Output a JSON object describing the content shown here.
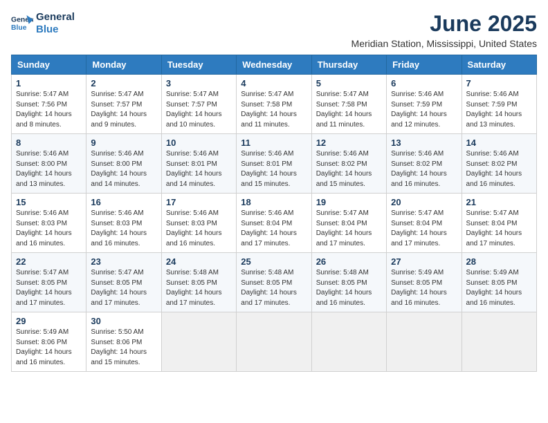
{
  "logo": {
    "line1": "General",
    "line2": "Blue"
  },
  "title": "June 2025",
  "subtitle": "Meridian Station, Mississippi, United States",
  "weekdays": [
    "Sunday",
    "Monday",
    "Tuesday",
    "Wednesday",
    "Thursday",
    "Friday",
    "Saturday"
  ],
  "weeks": [
    [
      {
        "day": "1",
        "sunrise": "Sunrise: 5:47 AM",
        "sunset": "Sunset: 7:56 PM",
        "daylight": "Daylight: 14 hours and 8 minutes."
      },
      {
        "day": "2",
        "sunrise": "Sunrise: 5:47 AM",
        "sunset": "Sunset: 7:57 PM",
        "daylight": "Daylight: 14 hours and 9 minutes."
      },
      {
        "day": "3",
        "sunrise": "Sunrise: 5:47 AM",
        "sunset": "Sunset: 7:57 PM",
        "daylight": "Daylight: 14 hours and 10 minutes."
      },
      {
        "day": "4",
        "sunrise": "Sunrise: 5:47 AM",
        "sunset": "Sunset: 7:58 PM",
        "daylight": "Daylight: 14 hours and 11 minutes."
      },
      {
        "day": "5",
        "sunrise": "Sunrise: 5:47 AM",
        "sunset": "Sunset: 7:58 PM",
        "daylight": "Daylight: 14 hours and 11 minutes."
      },
      {
        "day": "6",
        "sunrise": "Sunrise: 5:46 AM",
        "sunset": "Sunset: 7:59 PM",
        "daylight": "Daylight: 14 hours and 12 minutes."
      },
      {
        "day": "7",
        "sunrise": "Sunrise: 5:46 AM",
        "sunset": "Sunset: 7:59 PM",
        "daylight": "Daylight: 14 hours and 13 minutes."
      }
    ],
    [
      {
        "day": "8",
        "sunrise": "Sunrise: 5:46 AM",
        "sunset": "Sunset: 8:00 PM",
        "daylight": "Daylight: 14 hours and 13 minutes."
      },
      {
        "day": "9",
        "sunrise": "Sunrise: 5:46 AM",
        "sunset": "Sunset: 8:00 PM",
        "daylight": "Daylight: 14 hours and 14 minutes."
      },
      {
        "day": "10",
        "sunrise": "Sunrise: 5:46 AM",
        "sunset": "Sunset: 8:01 PM",
        "daylight": "Daylight: 14 hours and 14 minutes."
      },
      {
        "day": "11",
        "sunrise": "Sunrise: 5:46 AM",
        "sunset": "Sunset: 8:01 PM",
        "daylight": "Daylight: 14 hours and 15 minutes."
      },
      {
        "day": "12",
        "sunrise": "Sunrise: 5:46 AM",
        "sunset": "Sunset: 8:02 PM",
        "daylight": "Daylight: 14 hours and 15 minutes."
      },
      {
        "day": "13",
        "sunrise": "Sunrise: 5:46 AM",
        "sunset": "Sunset: 8:02 PM",
        "daylight": "Daylight: 14 hours and 16 minutes."
      },
      {
        "day": "14",
        "sunrise": "Sunrise: 5:46 AM",
        "sunset": "Sunset: 8:02 PM",
        "daylight": "Daylight: 14 hours and 16 minutes."
      }
    ],
    [
      {
        "day": "15",
        "sunrise": "Sunrise: 5:46 AM",
        "sunset": "Sunset: 8:03 PM",
        "daylight": "Daylight: 14 hours and 16 minutes."
      },
      {
        "day": "16",
        "sunrise": "Sunrise: 5:46 AM",
        "sunset": "Sunset: 8:03 PM",
        "daylight": "Daylight: 14 hours and 16 minutes."
      },
      {
        "day": "17",
        "sunrise": "Sunrise: 5:46 AM",
        "sunset": "Sunset: 8:03 PM",
        "daylight": "Daylight: 14 hours and 16 minutes."
      },
      {
        "day": "18",
        "sunrise": "Sunrise: 5:46 AM",
        "sunset": "Sunset: 8:04 PM",
        "daylight": "Daylight: 14 hours and 17 minutes."
      },
      {
        "day": "19",
        "sunrise": "Sunrise: 5:47 AM",
        "sunset": "Sunset: 8:04 PM",
        "daylight": "Daylight: 14 hours and 17 minutes."
      },
      {
        "day": "20",
        "sunrise": "Sunrise: 5:47 AM",
        "sunset": "Sunset: 8:04 PM",
        "daylight": "Daylight: 14 hours and 17 minutes."
      },
      {
        "day": "21",
        "sunrise": "Sunrise: 5:47 AM",
        "sunset": "Sunset: 8:04 PM",
        "daylight": "Daylight: 14 hours and 17 minutes."
      }
    ],
    [
      {
        "day": "22",
        "sunrise": "Sunrise: 5:47 AM",
        "sunset": "Sunset: 8:05 PM",
        "daylight": "Daylight: 14 hours and 17 minutes."
      },
      {
        "day": "23",
        "sunrise": "Sunrise: 5:47 AM",
        "sunset": "Sunset: 8:05 PM",
        "daylight": "Daylight: 14 hours and 17 minutes."
      },
      {
        "day": "24",
        "sunrise": "Sunrise: 5:48 AM",
        "sunset": "Sunset: 8:05 PM",
        "daylight": "Daylight: 14 hours and 17 minutes."
      },
      {
        "day": "25",
        "sunrise": "Sunrise: 5:48 AM",
        "sunset": "Sunset: 8:05 PM",
        "daylight": "Daylight: 14 hours and 17 minutes."
      },
      {
        "day": "26",
        "sunrise": "Sunrise: 5:48 AM",
        "sunset": "Sunset: 8:05 PM",
        "daylight": "Daylight: 14 hours and 16 minutes."
      },
      {
        "day": "27",
        "sunrise": "Sunrise: 5:49 AM",
        "sunset": "Sunset: 8:05 PM",
        "daylight": "Daylight: 14 hours and 16 minutes."
      },
      {
        "day": "28",
        "sunrise": "Sunrise: 5:49 AM",
        "sunset": "Sunset: 8:05 PM",
        "daylight": "Daylight: 14 hours and 16 minutes."
      }
    ],
    [
      {
        "day": "29",
        "sunrise": "Sunrise: 5:49 AM",
        "sunset": "Sunset: 8:06 PM",
        "daylight": "Daylight: 14 hours and 16 minutes."
      },
      {
        "day": "30",
        "sunrise": "Sunrise: 5:50 AM",
        "sunset": "Sunset: 8:06 PM",
        "daylight": "Daylight: 14 hours and 15 minutes."
      },
      null,
      null,
      null,
      null,
      null
    ]
  ]
}
